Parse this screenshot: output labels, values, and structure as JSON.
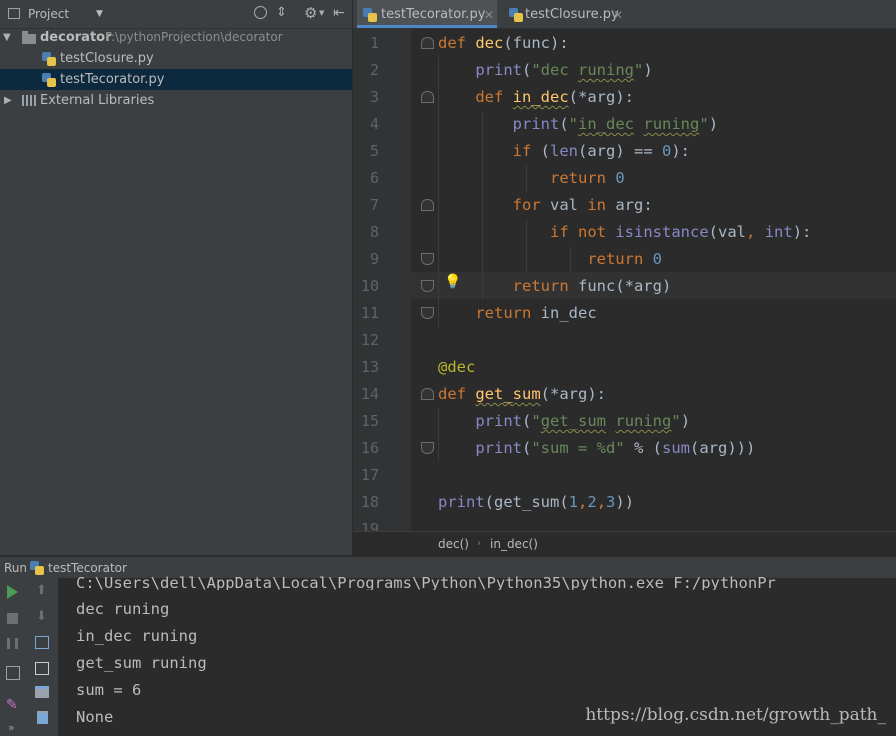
{
  "project_panel": {
    "title": "Project",
    "tree": {
      "root_label": "decorator",
      "root_path": "F:\\pythonProjection\\decorator",
      "files": [
        "testClosure.py",
        "testTecorator.py"
      ],
      "selected_file": "testTecorator.py",
      "external_libraries": "External Libraries"
    }
  },
  "editor": {
    "tabs": [
      {
        "label": "testTecorator.py",
        "active": true
      },
      {
        "label": "testClosure.py",
        "active": false
      }
    ],
    "line_numbers": [
      "1",
      "2",
      "3",
      "4",
      "5",
      "6",
      "7",
      "8",
      "9",
      "10",
      "11",
      "12",
      "13",
      "14",
      "15",
      "16",
      "17",
      "18",
      "19"
    ],
    "code_lines": [
      "def dec(func):",
      "    print(\"dec runing\")",
      "    def in_dec(*arg):",
      "        print(\"in_dec runing\")",
      "        if (len(arg) == 0):",
      "            return 0",
      "        for val in arg:",
      "            if not isinstance(val, int):",
      "                return 0",
      "        return func(*arg)",
      "    return in_dec",
      "",
      "@dec",
      "def get_sum(*arg):",
      "    print(\"get_sum runing\")",
      "    print(\"sum = %d\" % (sum(arg)))",
      "",
      "print(get_sum(1,2,3))",
      ""
    ],
    "breadcrumb": [
      "dec()",
      "in_dec()"
    ]
  },
  "run_panel": {
    "title": "Run",
    "config": "testTecorator",
    "console_lines": [
      "C:\\Users\\dell\\AppData\\Local\\Programs\\Python\\Python35\\python.exe F:/pythonPr",
      "dec runing",
      "in_dec runing",
      "get_sum runing",
      "sum = 6",
      "None"
    ]
  },
  "watermark": "https://blog.csdn.net/growth_path_",
  "colors": {
    "keyword": "#cc7832",
    "function": "#ffc66d",
    "builtin": "#8888c6",
    "string": "#6a8759",
    "number": "#6897bb",
    "decorator": "#bbb529",
    "run_green": "#499c54"
  }
}
